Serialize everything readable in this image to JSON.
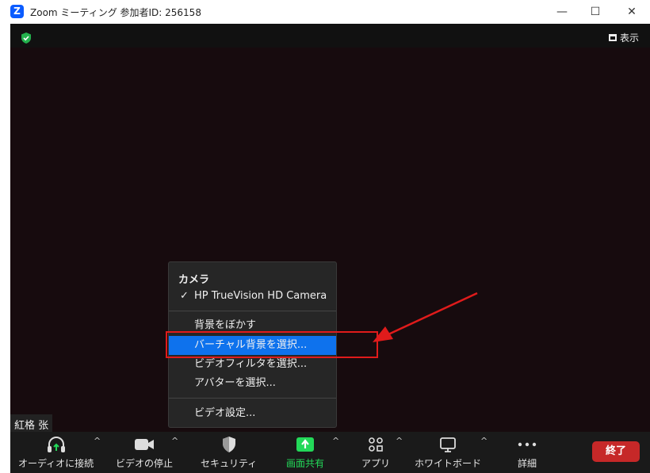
{
  "window": {
    "logo_letter": "Z",
    "title": "Zoom ミーティング 参加者ID: 256158",
    "minimize": "—",
    "maximize": "☐",
    "close": "✕"
  },
  "meeting": {
    "view_label": "表示",
    "participant_name": "紅格 张"
  },
  "menu": {
    "heading": "カメラ",
    "camera_item": "HP TrueVision HD Camera",
    "checkmark": "✓",
    "items": [
      "背景をぼかす",
      "バーチャル背景を選択...",
      "ビデオフィルタを選択...",
      "アバターを選択...",
      "ビデオ設定..."
    ],
    "selected_index": 1
  },
  "toolbar": {
    "audio": "オーディオに接続",
    "video": "ビデオの停止",
    "security": "セキュリティ",
    "share": "画面共有",
    "apps": "アプリ",
    "whiteboard": "ホワイトボード",
    "more": "詳細",
    "end": "終了",
    "caret": "^"
  },
  "colors": {
    "accent": "#0e72ed",
    "share_green": "#23d959",
    "end_red": "#c62828",
    "annotation_red": "#e01b1b",
    "meeting_bg": "#170b0e"
  }
}
